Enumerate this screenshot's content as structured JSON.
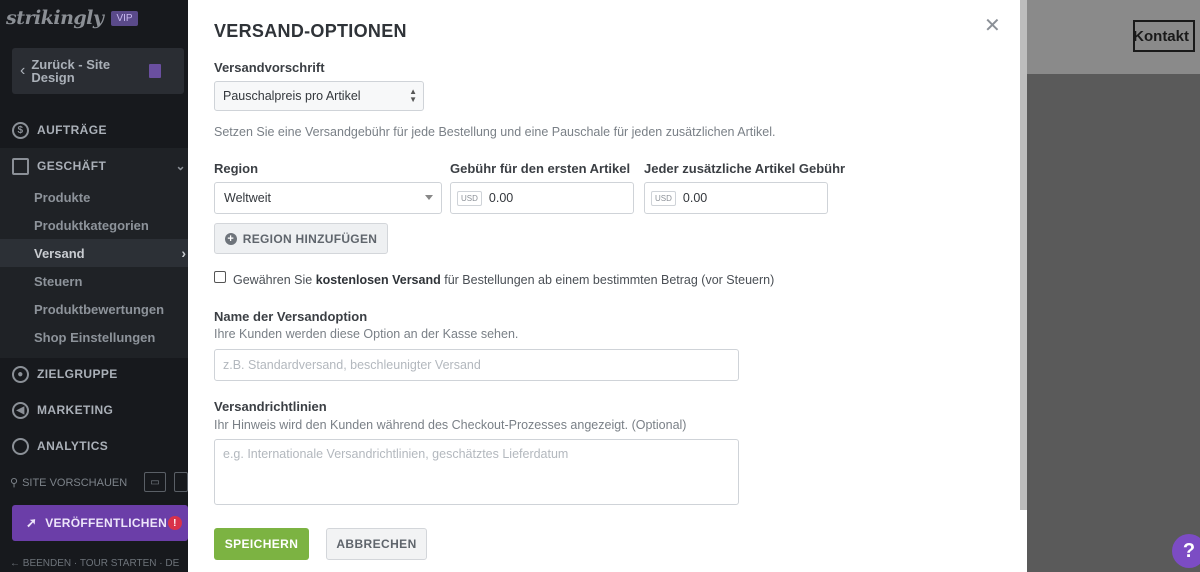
{
  "sidebar": {
    "logo": "strikingly",
    "vip_badge": "VIP",
    "back_label": "Zurück - Site Design",
    "sections": {
      "auftraege": "AUFTRÄGE",
      "geschaeft": "GESCHÄFT",
      "zielgruppe": "ZIELGRUPPE",
      "marketing": "MARKETING",
      "analytics": "ANALYTICS"
    },
    "sub_items": [
      "Produkte",
      "Produktkategorien",
      "Versand",
      "Steuern",
      "Produktbewertungen",
      "Shop Einstellungen"
    ],
    "active_item": "Versand",
    "preview_label": "SITE VORSCHAUEN",
    "publish_label": "VERÖFFENTLICHEN",
    "footer_links": "← BEENDEN · TOUR STARTEN · DE"
  },
  "page": {
    "contact_button": "Kontakt"
  },
  "modal": {
    "title": "VERSAND-OPTIONEN",
    "rule_label": "Versandvorschrift",
    "rule_value": "Pauschalpreis pro Artikel",
    "rule_description": "Setzen Sie eine Versandgebühr für jede Bestellung und eine Pauschale für jeden zusätzlichen Artikel.",
    "region_label": "Region",
    "first_fee_label": "Gebühr für den ersten Artikel",
    "additional_fee_label": "Jeder zusätzliche Artikel Gebühr",
    "region_value": "Weltweit",
    "currency": "USD",
    "first_fee_value": "0.00",
    "additional_fee_value": "0.00",
    "add_region_label": "REGION HINZUFÜGEN",
    "free_shipping_pre": "Gewähren Sie ",
    "free_shipping_bold": "kostenlosen Versand",
    "free_shipping_post": " für Bestellungen ab einem bestimmten Betrag (vor Steuern)",
    "option_name_label": "Name der Versandoption",
    "option_name_hint": "Ihre Kunden werden diese Option an der Kasse sehen.",
    "option_name_placeholder": "z.B. Standardversand, beschleunigter Versand",
    "policy_label": "Versandrichtlinien",
    "policy_hint": "Ihr Hinweis wird den Kunden während des Checkout-Prozesses angezeigt. (Optional)",
    "policy_placeholder": "e.g. Internationale Versandrichtlinien, geschätztes Lieferdatum",
    "save_label": "SPEICHERN",
    "cancel_label": "ABBRECHEN"
  },
  "colors": {
    "save_green": "#7cb342",
    "publish_purple": "#6b3ea8",
    "sidebar_bg": "#17191d"
  }
}
